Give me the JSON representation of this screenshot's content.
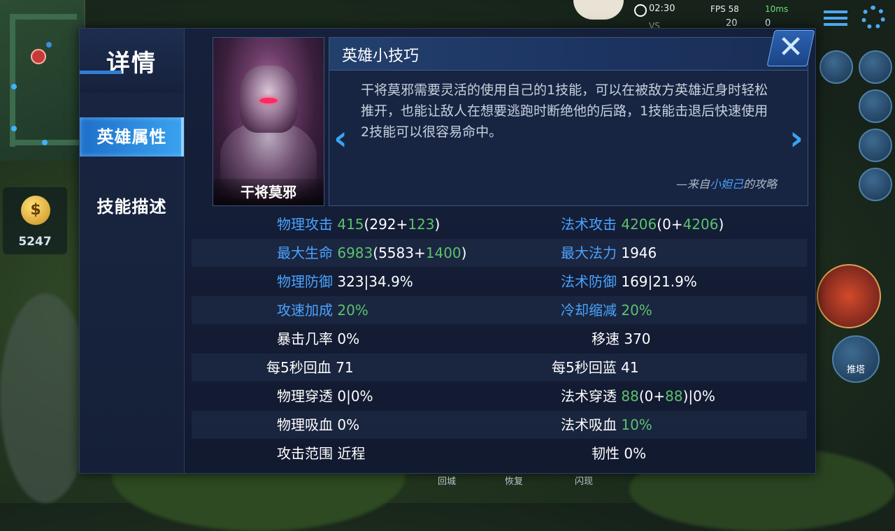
{
  "hud": {
    "time": "02:30",
    "fps": "FPS 58",
    "ping": "10ms",
    "vs": "VS",
    "score_left": "20",
    "score_right": "0",
    "gold": "5247",
    "gold_icon_glyph": "$",
    "push_tower": "推塔",
    "bottom_labels": [
      "回城",
      "恢复",
      "闪现"
    ]
  },
  "dialog": {
    "title": "详情",
    "tabs": [
      {
        "label": "英雄属性",
        "active": true
      },
      {
        "label": "技能描述",
        "active": false
      }
    ],
    "hero": {
      "name": "干将莫邪"
    },
    "tips": {
      "title": "英雄小技巧",
      "text": "干将莫邪需要灵活的使用自己的1技能，可以在被敌方英雄近身时轻松推开，也能让敌人在想要逃跑时断绝他的后路，1技能击退后快速使用2技能可以很容易命中。",
      "credit_prefix": "—来自",
      "credit_author": "小妲己",
      "credit_suffix": "的攻略",
      "left_arrow": "‹",
      "right_arrow": "›"
    },
    "close_label": "✕"
  },
  "stats": {
    "phys_attack": {
      "label": "物理攻击",
      "total": "415",
      "base": "292",
      "bonus": "123"
    },
    "magic_attack": {
      "label": "法术攻击",
      "total": "4206",
      "base": "0",
      "bonus": "4206"
    },
    "max_hp": {
      "label": "最大生命",
      "total": "6983",
      "base": "5583",
      "bonus": "1400"
    },
    "max_mana": {
      "label": "最大法力",
      "value": "1946"
    },
    "phys_def": {
      "label": "物理防御",
      "value": "323|34.9%"
    },
    "magic_def": {
      "label": "法术防御",
      "value": "169|21.9%"
    },
    "attack_speed": {
      "label": "攻速加成",
      "value": "20%"
    },
    "cooldown": {
      "label": "冷却缩减",
      "value": "20%"
    },
    "crit": {
      "label": "暴击几率",
      "value": "0%"
    },
    "move_speed": {
      "label": "移速",
      "value": "370"
    },
    "hp_regen": {
      "label": "每5秒回血",
      "value": "71"
    },
    "mana_regen": {
      "label": "每5秒回蓝",
      "value": "41"
    },
    "phys_pen": {
      "label": "物理穿透",
      "value": "0|0%"
    },
    "magic_pen": {
      "label": "法术穿透",
      "total": "88",
      "base": "0",
      "bonus": "88",
      "pct": "|0%"
    },
    "lifesteal": {
      "label": "物理吸血",
      "value": "0%"
    },
    "spell_vamp": {
      "label": "法术吸血",
      "value": "10%"
    },
    "range": {
      "label": "攻击范围",
      "value": "近程"
    },
    "tenacity": {
      "label": "韧性",
      "value": "0%"
    }
  },
  "colors": {
    "label_blue": "#4aa3ff",
    "bonus_green": "#5cc26d",
    "tab_active": "#2f8ae0",
    "dialog_bg": "#141d35"
  },
  "icons": [
    "close-icon",
    "chevron-left-icon",
    "chevron-right-icon",
    "gold-coin-icon",
    "settings-icon",
    "menu-icon",
    "pause-icon",
    "sword-icon",
    "shield-icon",
    "flag-icon",
    "chat-icon"
  ]
}
